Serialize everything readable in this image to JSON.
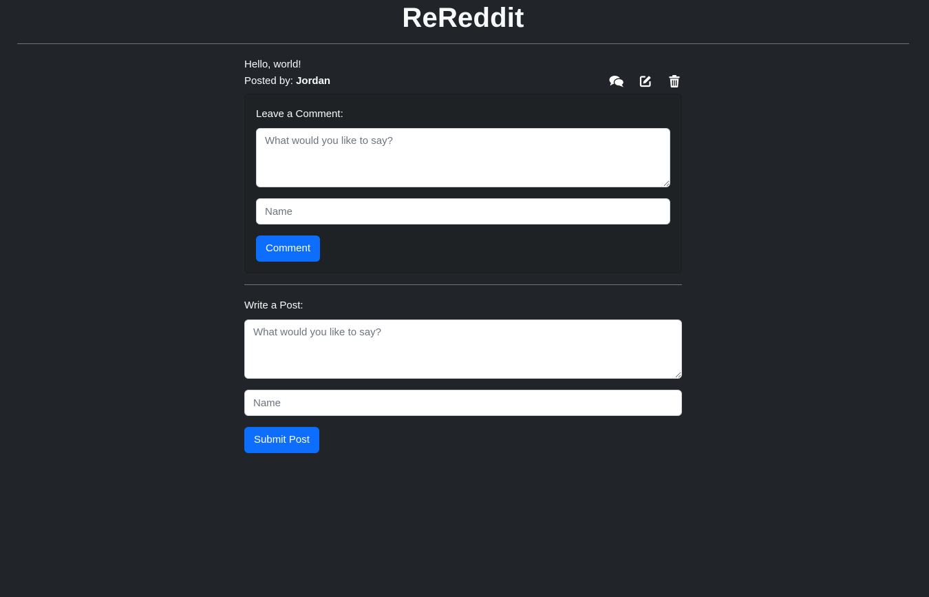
{
  "site": {
    "title": "ReReddit"
  },
  "post": {
    "body": "Hello, world!",
    "posted_by_label": "Posted by:",
    "author": "Jordan",
    "actions": {
      "comments_icon": "comments-icon",
      "edit_icon": "edit-icon",
      "delete_icon": "trash-icon"
    }
  },
  "comment_form": {
    "label": "Leave a Comment:",
    "text_placeholder": "What would you like to say?",
    "text_value": "",
    "name_placeholder": "Name",
    "name_value": "",
    "submit_label": "Comment"
  },
  "post_form": {
    "label": "Write a Post:",
    "text_placeholder": "What would you like to say?",
    "text_value": "",
    "name_placeholder": "Name",
    "name_value": "",
    "submit_label": "Submit Post"
  },
  "colors": {
    "background": "#212529",
    "primary": "#0d6efd",
    "text": "#f8f9fa",
    "divider": "#6c757d"
  }
}
